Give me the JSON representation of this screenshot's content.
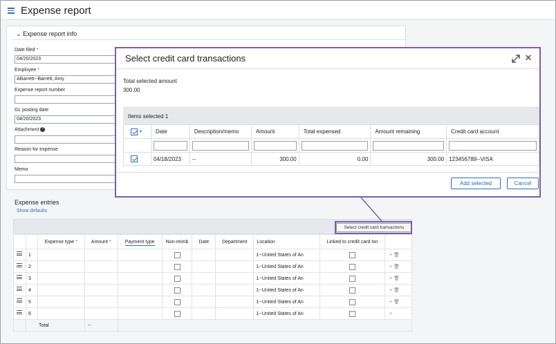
{
  "page": {
    "title": "Expense report"
  },
  "info_section": {
    "header": "Expense report info",
    "fields": [
      {
        "label": "Date filed",
        "required": true,
        "value": "04/20/2023"
      },
      {
        "label": "Employee",
        "required": true,
        "value": "ABarrett--Barrett, Amy"
      },
      {
        "label": "Expense report number",
        "required": false,
        "value": ""
      },
      {
        "label": "GL posting date",
        "required": false,
        "value": "04/20/2023"
      },
      {
        "label": "Attachment",
        "required": false,
        "value": ""
      },
      {
        "label": "Reason for expense",
        "required": false,
        "value": ""
      },
      {
        "label": "Memo",
        "required": false,
        "value": ""
      }
    ]
  },
  "entries": {
    "title": "Expense entries",
    "show_defaults": "Show defaults",
    "select_cc_button": "Select credit card transactions",
    "columns": [
      "",
      "",
      "Expense type",
      "Amount",
      "Payment type",
      "Non-reimb",
      "Date",
      "Department",
      "Location",
      "Linked to credit card txn",
      ""
    ],
    "required_columns": [
      "Expense type",
      "Amount"
    ],
    "rows": [
      {
        "num": "1",
        "location": "1--United States of An"
      },
      {
        "num": "2",
        "location": "1--United States of An"
      },
      {
        "num": "3",
        "location": "1--United States of An"
      },
      {
        "num": "4",
        "location": "1--United States of An"
      },
      {
        "num": "5",
        "location": "1--United States of An"
      },
      {
        "num": "6",
        "location": "1--United States of An"
      }
    ],
    "total_label": "Total",
    "total_value": "--"
  },
  "modal": {
    "title": "Select credit card transactions",
    "total_selected_label": "Total selected amount",
    "total_selected_value": "300.00",
    "items_selected": "Items selected 1",
    "columns": [
      "Date",
      "Description/memo",
      "Amount",
      "Total expensed",
      "Amount remaining",
      "Credit card account"
    ],
    "rows": [
      {
        "date": "04/18/2023",
        "description": "--",
        "amount": "300.00",
        "total_expensed": "0.00",
        "amount_remaining": "300.00",
        "account": "123456789--VISA"
      }
    ],
    "add_selected": "Add selected",
    "cancel": "Cancel"
  },
  "colors": {
    "accent": "#2f6db5",
    "highlight": "#7b5ea7",
    "required": "#c0392b"
  }
}
